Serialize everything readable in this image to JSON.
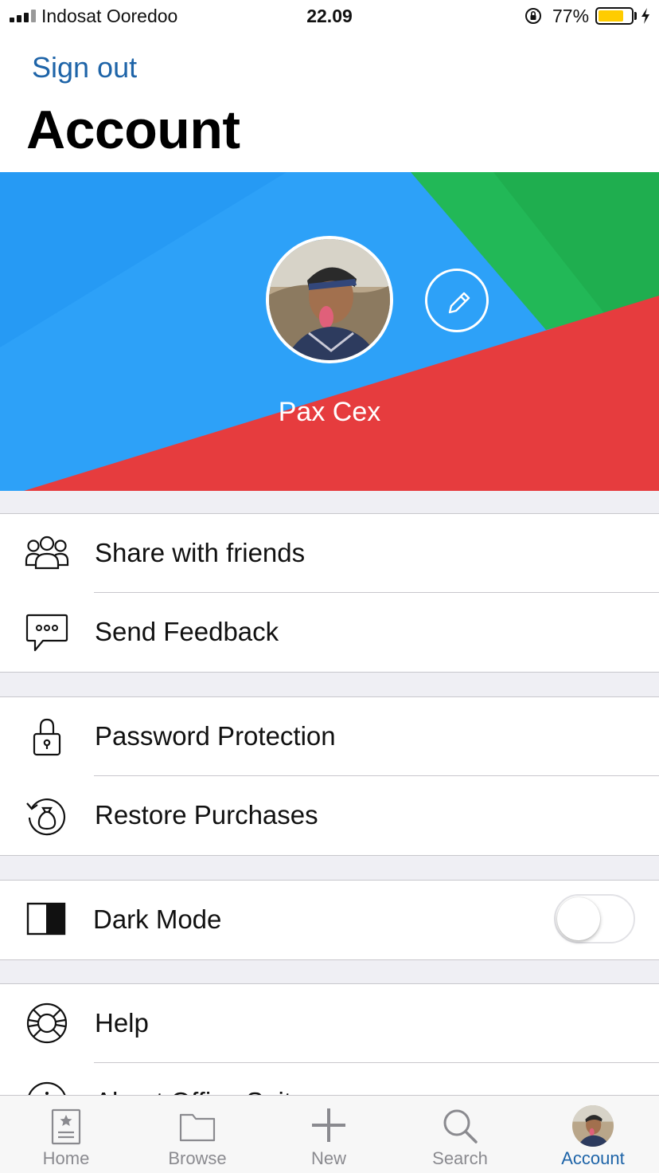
{
  "status_bar": {
    "carrier": "Indosat Ooredoo",
    "time": "22.09",
    "battery_percent": "77%",
    "battery_level": 0.77,
    "battery_color": "#ffcc00",
    "icons": [
      "signal-icon",
      "orientation-lock-icon",
      "battery-icon",
      "charging-bolt-icon"
    ]
  },
  "header": {
    "sign_out": "Sign out",
    "title": "Account"
  },
  "profile": {
    "name": "Pax Cex",
    "edit_icon": "pencil-icon",
    "banner_colors": [
      "#2da1f8",
      "#22b857",
      "#e63c3e"
    ]
  },
  "groups": [
    {
      "items": [
        {
          "label": "Share with friends",
          "icon": "people-icon"
        },
        {
          "label": "Send Feedback",
          "icon": "chat-bubble-icon"
        }
      ]
    },
    {
      "items": [
        {
          "label": "Password Protection",
          "icon": "lock-icon"
        },
        {
          "label": "Restore Purchases",
          "icon": "restore-purchase-icon"
        }
      ]
    },
    {
      "items": [
        {
          "label": "Dark Mode",
          "icon": "half-contrast-icon",
          "toggle": false
        }
      ]
    },
    {
      "items": [
        {
          "label": "Help",
          "icon": "lifebuoy-icon"
        },
        {
          "label": "About Office Suite",
          "icon": "info-icon"
        }
      ]
    }
  ],
  "tab_bar": {
    "tabs": [
      {
        "label": "Home",
        "icon": "home-document-icon"
      },
      {
        "label": "Browse",
        "icon": "folder-icon"
      },
      {
        "label": "New",
        "icon": "plus-icon"
      },
      {
        "label": "Search",
        "icon": "search-icon"
      },
      {
        "label": "Account",
        "icon": "avatar-icon",
        "active": true
      }
    ],
    "active_color": "#1e64a8",
    "inactive_color": "#8a8a8f"
  }
}
